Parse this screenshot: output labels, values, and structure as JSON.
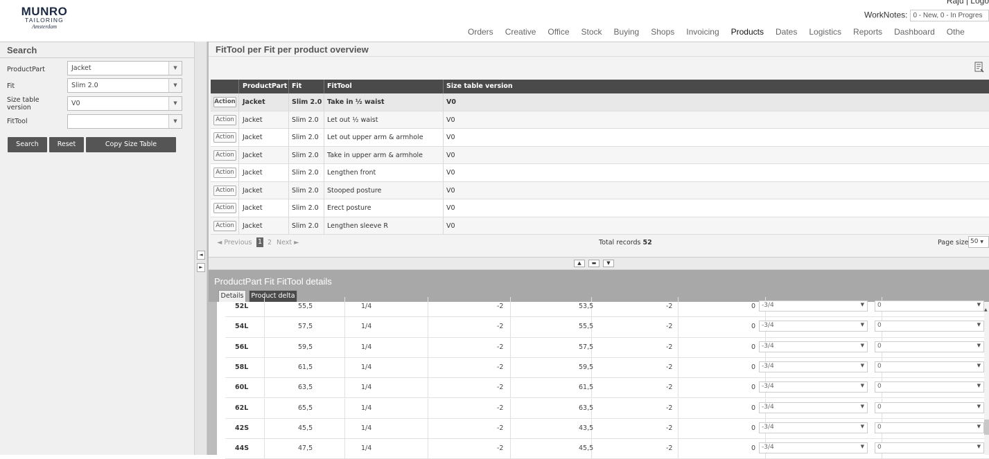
{
  "brand": {
    "name": "MUNRO",
    "sub": "TAILORING",
    "city": "Amsterdam"
  },
  "user_line": "Raju  | Logo",
  "worknotes": {
    "label": "WorkNotes:",
    "value": "0 - New, 0 - In Progres"
  },
  "nav": [
    "Orders",
    "Creative",
    "Office",
    "Stock",
    "Buying",
    "Shops",
    "Invoicing",
    "Products",
    "Dates",
    "Logistics",
    "Reports",
    "Dashboard",
    "Othe"
  ],
  "nav_active": "Products",
  "search": {
    "title": "Search",
    "fields": [
      {
        "label": "ProductPart",
        "value": "Jacket"
      },
      {
        "label": "Fit",
        "value": "Slim 2.0"
      },
      {
        "label": "Size table version",
        "value": "V0"
      },
      {
        "label": "FitTool",
        "value": ""
      }
    ],
    "buttons": {
      "search": "Search",
      "reset": "Reset",
      "copy": "Copy Size Table"
    }
  },
  "overview": {
    "title": "FitTool per Fit per product overview",
    "columns": [
      "ProductPart",
      "Fit",
      "FitTool",
      "Size table version"
    ],
    "action_label": "Action",
    "rows": [
      [
        "Jacket",
        "Slim 2.0",
        "Take in ½ waist",
        "V0"
      ],
      [
        "Jacket",
        "Slim 2.0",
        "Let out ½ waist",
        "V0"
      ],
      [
        "Jacket",
        "Slim 2.0",
        "Let out upper arm & armhole",
        "V0"
      ],
      [
        "Jacket",
        "Slim 2.0",
        "Take in upper arm & armhole",
        "V0"
      ],
      [
        "Jacket",
        "Slim 2.0",
        "Lengthen front",
        "V0"
      ],
      [
        "Jacket",
        "Slim 2.0",
        "Stooped posture",
        "V0"
      ],
      [
        "Jacket",
        "Slim 2.0",
        "Erect posture",
        "V0"
      ],
      [
        "Jacket",
        "Slim 2.0",
        "Lengthen sleeve R",
        "V0"
      ]
    ],
    "pager": {
      "prev": "◄ Previous",
      "page1": "1",
      "page2": "2",
      "next": "Next ►",
      "total_label": "Total records",
      "total": "52",
      "page_size_label": "Page size",
      "page_size": "50"
    }
  },
  "details": {
    "title": "ProductPart Fit FitTool details",
    "tabs": [
      "Details",
      "Product delta"
    ],
    "rows": [
      [
        "52L",
        "55,5",
        "1/4",
        "-2",
        "53,5",
        "-2",
        "0",
        "-3/4",
        "0"
      ],
      [
        "54L",
        "57,5",
        "1/4",
        "-2",
        "55,5",
        "-2",
        "0",
        "-3/4",
        "0"
      ],
      [
        "56L",
        "59,5",
        "1/4",
        "-2",
        "57,5",
        "-2",
        "0",
        "-3/4",
        "0"
      ],
      [
        "58L",
        "61,5",
        "1/4",
        "-2",
        "59,5",
        "-2",
        "0",
        "-3/4",
        "0"
      ],
      [
        "60L",
        "63,5",
        "1/4",
        "-2",
        "61,5",
        "-2",
        "0",
        "-3/4",
        "0"
      ],
      [
        "62L",
        "65,5",
        "1/4",
        "-2",
        "63,5",
        "-2",
        "0",
        "-3/4",
        "0"
      ],
      [
        "42S",
        "45,5",
        "1/4",
        "-2",
        "43,5",
        "-2",
        "0",
        "-3/4",
        "0"
      ],
      [
        "44S",
        "47,5",
        "1/4",
        "-2",
        "45,5",
        "-2",
        "0",
        "-3/4",
        "0"
      ]
    ]
  }
}
